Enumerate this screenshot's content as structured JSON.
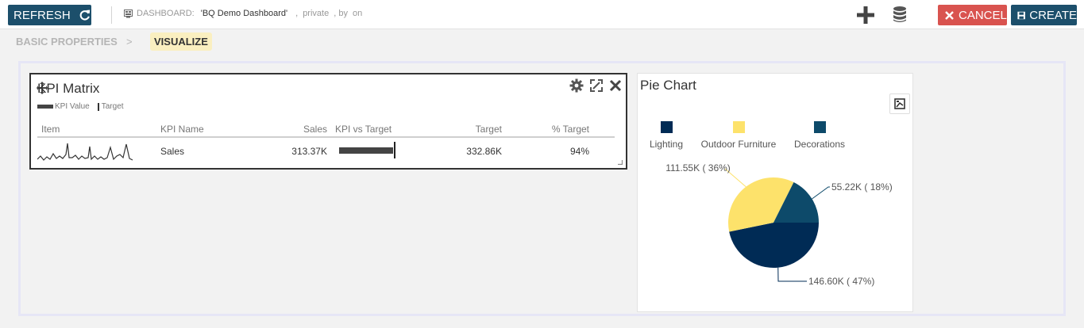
{
  "toolbar": {
    "refresh_label": "REFRESH",
    "dashboard_label": "DASHBOARD:",
    "dashboard_name": "'BQ Demo Dashboard'",
    "comma1": ",",
    "visibility": "private",
    "by_label": ", by",
    "on_label": "on",
    "cancel_label": "CANCEL",
    "create_label": "CREATE"
  },
  "breadcrumb": {
    "step1": "BASIC PROPERTIES",
    "separator": ">",
    "step2": "VISUALIZE"
  },
  "kpi_widget": {
    "title": "KPI Matrix",
    "legend": {
      "value_label": "KPI Value",
      "target_label": "Target"
    },
    "columns": [
      "Item",
      "KPI Name",
      "Sales",
      "KPI vs Target",
      "Target",
      "% Target"
    ],
    "rows": [
      {
        "name": "Sales",
        "sales": "313.37K",
        "target": "332.86K",
        "pct": "94%",
        "pct_value": 0.94
      }
    ]
  },
  "pie_widget": {
    "title": "Pie Chart",
    "legend": [
      "Lighting",
      "Outdoor Furniture",
      "Decorations"
    ],
    "colors": {
      "lighting": "#002b55",
      "outdoor_furniture": "#fde26b",
      "decorations": "#0d4a6a"
    }
  },
  "chart_data": {
    "type": "pie",
    "title": "Pie Chart",
    "categories": [
      "Lighting",
      "Outdoor Furniture",
      "Decorations"
    ],
    "values": [
      146.6,
      111.55,
      55.22
    ],
    "units": "K",
    "labels": [
      "146.60K ( 47%)",
      "111.55K ( 36%)",
      "55.22K ( 18%)"
    ],
    "legend_position": "top"
  },
  "colors": {
    "primary": "#1c4f6b",
    "danger": "#d9534f",
    "highlight": "#faefc0"
  }
}
